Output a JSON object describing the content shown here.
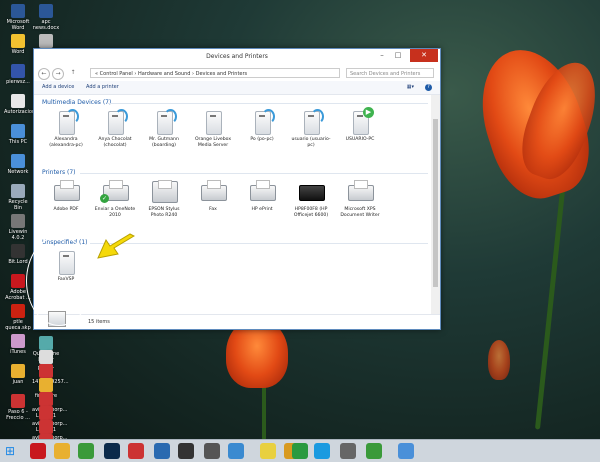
{
  "window": {
    "title": "Devices and Printers",
    "address": "« Control Panel › Hardware and Sound › Devices and Printers",
    "search_placeholder": "Search Devices and Printers",
    "toolbar": {
      "add_device": "Add a device",
      "add_printer": "Add a printer"
    },
    "sections": {
      "multimedia": {
        "title": "Multimedia Devices (7)",
        "items": [
          {
            "label": "Alexandra (alexandra-pc)",
            "kind": "media"
          },
          {
            "label": "Anya Chocolat (chocolat)",
            "kind": "media"
          },
          {
            "label": "Mr. Gutmann (boarding)",
            "kind": "media"
          },
          {
            "label": "Orange Livebox Media Server",
            "kind": "media-plain"
          },
          {
            "label": "Po (po-pc)",
            "kind": "media"
          },
          {
            "label": "usuario (usuario-pc)",
            "kind": "media"
          },
          {
            "label": "USUARIO-PC",
            "kind": "media-play"
          }
        ]
      },
      "printers": {
        "title": "Printers (7)",
        "items": [
          {
            "label": "Adobe PDF",
            "kind": "printer"
          },
          {
            "label": "Enviar a OneNote 2010",
            "kind": "printer-default"
          },
          {
            "label": "EPSON Stylus Photo R240",
            "kind": "printer-photo"
          },
          {
            "label": "Fax",
            "kind": "fax"
          },
          {
            "label": "HP ePrint",
            "kind": "printer"
          },
          {
            "label": "HP8F00F8 (HP Officejet 6600)",
            "kind": "printer-dark"
          },
          {
            "label": "Microsoft XPS Document Writer",
            "kind": "printer"
          }
        ]
      },
      "unspecified": {
        "title": "Unspecified (1)",
        "items": [
          {
            "label": "FaxVSP",
            "kind": "box"
          }
        ]
      }
    },
    "status": {
      "count": "15 items"
    }
  },
  "desktop_icons": [
    {
      "label": "Microsoft Word",
      "color": "#2b5797"
    },
    {
      "label": "Word",
      "color": "#f2c230"
    },
    {
      "label": "pierwsz...",
      "color": "#3355aa"
    },
    {
      "label": "Autorizacion",
      "color": "#e8e8e8"
    },
    {
      "label": "This PC",
      "color": "#4a90d9"
    },
    {
      "label": "Network",
      "color": "#4a90d9"
    },
    {
      "label": "Recycle Bin",
      "color": "#9ab"
    },
    {
      "label": "Livewin 4.0.2",
      "color": "#777"
    },
    {
      "label": "Bit.Lord",
      "color": "#333"
    },
    {
      "label": "Adobe Acrobat ...",
      "color": "#c8181e"
    },
    {
      "label": "ptle queca.skp",
      "color": "#c21"
    },
    {
      "label": "iTunes",
      "color": "#c9c"
    },
    {
      "label": "juan",
      "color": "#e8b030"
    },
    {
      "label": "Paso 6 - Freccio ...",
      "color": "#c33"
    },
    {
      "label": "apc news.docx",
      "color": "#2b5797"
    },
    {
      "label": "20140602 IMADEC...",
      "color": "#bbb"
    },
    {
      "label": "QuickTime Player",
      "color": "#5aa"
    },
    {
      "label": "photo-1.JPG",
      "color": "#ddd"
    },
    {
      "label": "1418259257...",
      "color": "#c33"
    },
    {
      "label": "firmware",
      "color": "#e8b030"
    },
    {
      "label": "aviad_floorp... Layout1 (1)...",
      "color": "#c33"
    },
    {
      "label": "aviad_floorp... Layout1 (1)...",
      "color": "#c33"
    },
    {
      "label": "aviad_floorp... Layout1 (1)...",
      "color": "#c33"
    },
    {
      "label": "RyanairBoo...",
      "color": "#c33"
    }
  ],
  "taskbar": [
    {
      "name": "start-button",
      "color": "#1e88e5"
    },
    {
      "name": "adobe-reader-icon",
      "color": "#c8181e"
    },
    {
      "name": "file-explorer-icon",
      "color": "#e8b030"
    },
    {
      "name": "chrome-icon",
      "color": "#3a9a3a"
    },
    {
      "name": "photoshop-icon",
      "color": "#0b2a4a"
    },
    {
      "name": "sketchup-icon",
      "color": "#c33"
    },
    {
      "name": "earth-icon",
      "color": "#2a6ab0"
    },
    {
      "name": "app-icon",
      "color": "#333"
    },
    {
      "name": "movie-icon",
      "color": "#555"
    },
    {
      "name": "cloud-icon",
      "color": "#3a8ad0"
    },
    {
      "name": "sticky-notes-icon",
      "color": "#e8d040"
    },
    {
      "name": "folder-icon",
      "color": "#d89a20"
    },
    {
      "name": "spotify-icon",
      "color": "#2a9a40"
    },
    {
      "name": "skype-icon",
      "color": "#1a9ae0"
    },
    {
      "name": "calendar-icon",
      "color": "#666"
    },
    {
      "name": "chrome-icon-2",
      "color": "#3a9a3a"
    },
    {
      "name": "devices-icon",
      "color": "#4a90d9"
    }
  ],
  "colors": {
    "accent": "#1e5ba8",
    "close": "#c7301d"
  }
}
